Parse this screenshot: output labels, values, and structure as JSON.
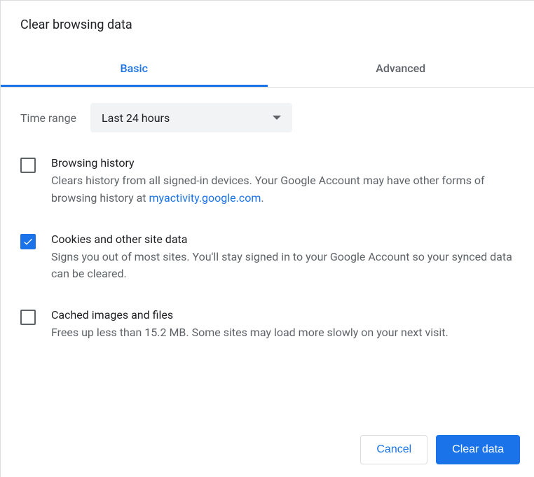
{
  "title": "Clear browsing data",
  "tabs": {
    "basic": "Basic",
    "advanced": "Advanced"
  },
  "timerange": {
    "label": "Time range",
    "value": "Last 24 hours"
  },
  "options": {
    "history": {
      "title": "Browsing history",
      "desc_before": "Clears history from all signed-in devices. Your Google Account may have other forms of browsing history at ",
      "link": "myactivity.google.com",
      "desc_after": ".",
      "checked": false
    },
    "cookies": {
      "title": "Cookies and other site data",
      "desc": "Signs you out of most sites. You'll stay signed in to your Google Account so your synced data can be cleared.",
      "checked": true
    },
    "cache": {
      "title": "Cached images and files",
      "desc": "Frees up less than 15.2 MB. Some sites may load more slowly on your next visit.",
      "checked": false
    }
  },
  "buttons": {
    "cancel": "Cancel",
    "clear": "Clear data"
  }
}
